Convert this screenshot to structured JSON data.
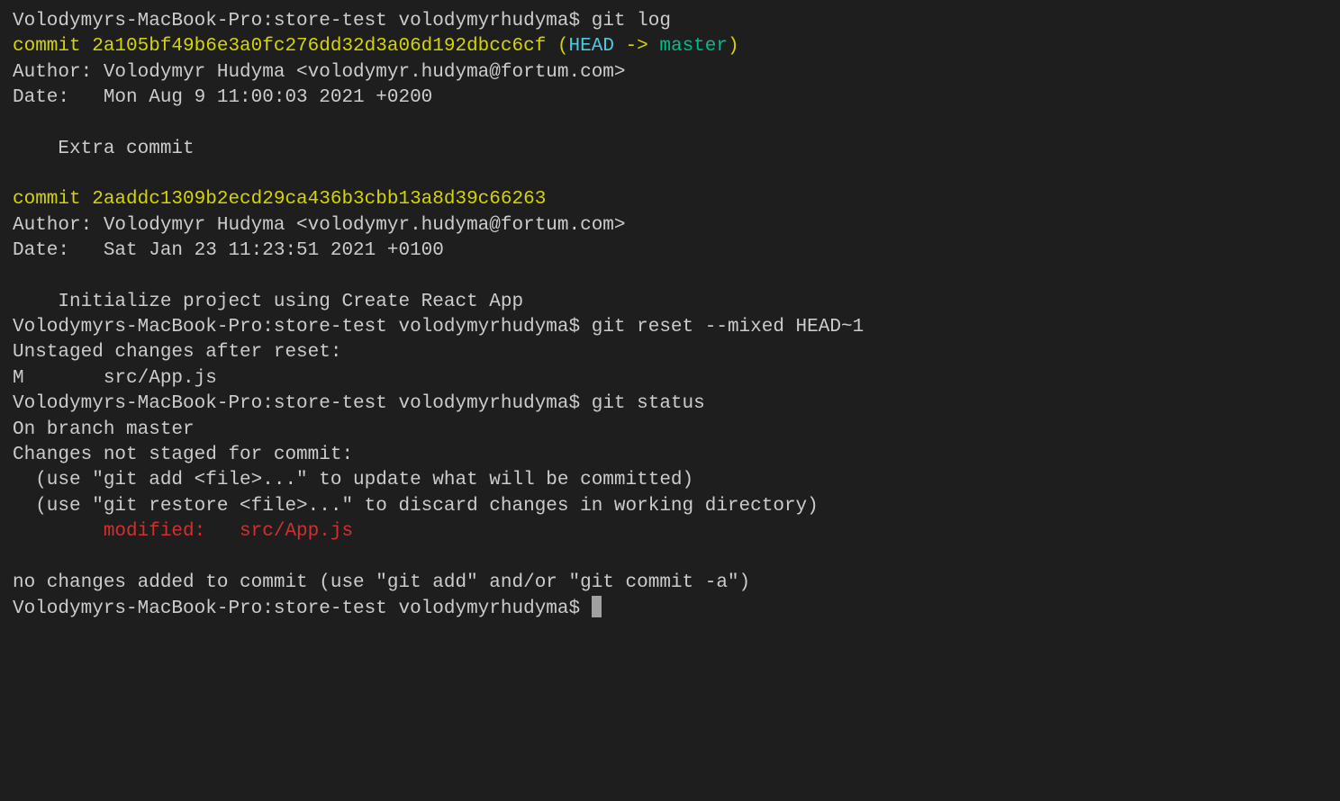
{
  "lines": {
    "0": {
      "prompt": "Volodymyrs-MacBook-Pro:store-test volodymyrhudyma$",
      "command": "git log"
    },
    "1": {
      "commit": "commit 2a105bf49b6e3a0fc276dd32d3a06d192dbcc6cf",
      "openParen": "(",
      "head": "HEAD",
      "arrow": " ->",
      "branch": "master",
      "closeParen": ")"
    },
    "2": "Author: Volodymyr Hudyma <volodymyr.hudyma@fortum.com>",
    "3": "Date:   Mon Aug 9 11:00:03 2021 +0200",
    "4": "",
    "5": "    Extra commit",
    "6": "",
    "7": "commit 2aaddc1309b2ecd29ca436b3cbb13a8d39c66263",
    "8": "Author: Volodymyr Hudyma <volodymyr.hudyma@fortum.com>",
    "9": "Date:   Sat Jan 23 11:23:51 2021 +0100",
    "10": "",
    "11": "    Initialize project using Create React App",
    "12": {
      "prompt": "Volodymyrs-MacBook-Pro:store-test volodymyrhudyma$",
      "command": "git reset --mixed HEAD~1"
    },
    "13": "Unstaged changes after reset:",
    "14": "M       src/App.js",
    "15": {
      "prompt": "Volodymyrs-MacBook-Pro:store-test volodymyrhudyma$",
      "command": "git status"
    },
    "16": "On branch master",
    "17": "Changes not staged for commit:",
    "18": "  (use \"git add <file>...\" to update what will be committed)",
    "19": "  (use \"git restore <file>...\" to discard changes in working directory)",
    "20": "        modified:   src/App.js",
    "21": "",
    "22": "no changes added to commit (use \"git add\" and/or \"git commit -a\")",
    "23": {
      "prompt": "Volodymyrs-MacBook-Pro:store-test volodymyrhudyma$"
    }
  }
}
